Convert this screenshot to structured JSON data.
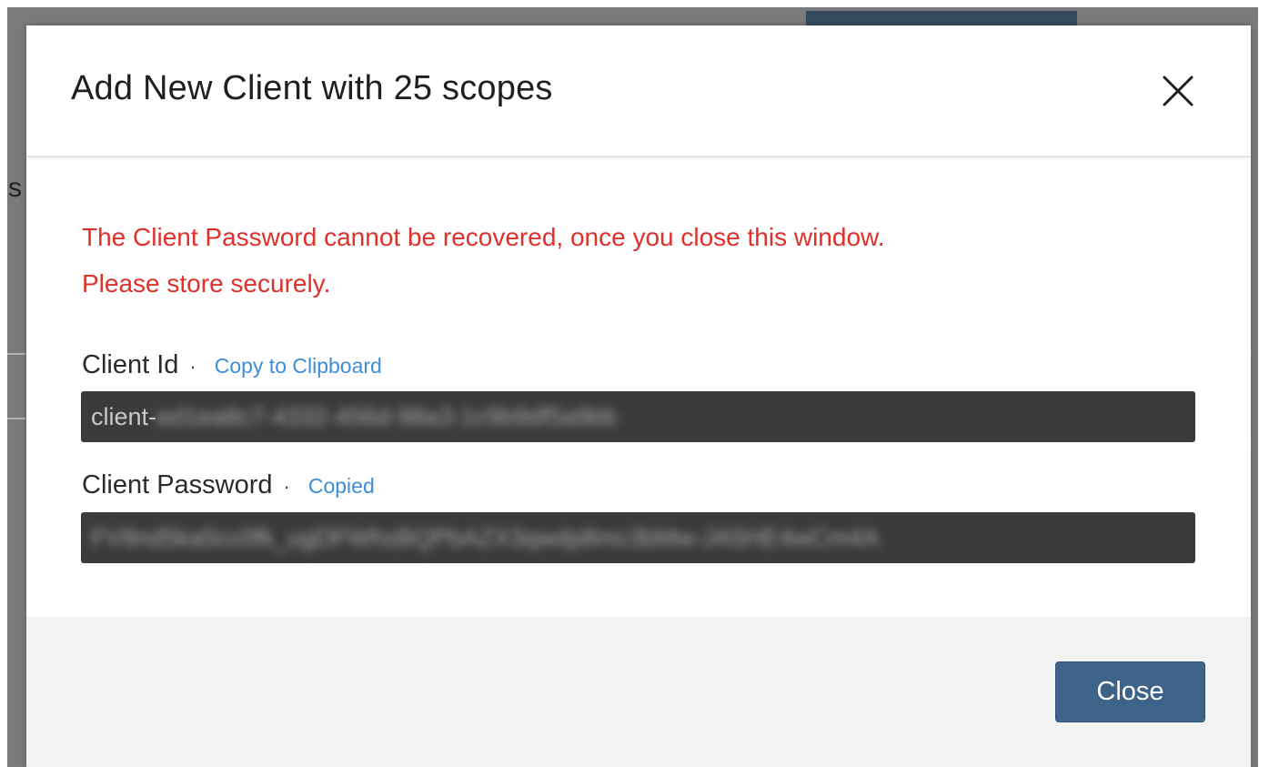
{
  "dialog": {
    "title": "Add New Client with 25 scopes",
    "close_icon": "close-icon",
    "warning_line1": "The Client Password cannot be recovered, once you close this window.",
    "warning_line2": "Please store securely.",
    "client_id": {
      "label": "Client Id",
      "separator": "·",
      "action": "Copy to Clipboard",
      "value_prefix": "client-",
      "value_masked": "ed1ea8c7-4332-456d-98a3-1c9b9df5a9bb"
    },
    "client_password": {
      "label": "Client Password",
      "separator": "·",
      "action": "Copied",
      "value_masked": "FV8nd5ka5cc0fk_ugDFWhsBQPbAZX3qwdp8mc3bMw-J4SHE4wCm4A"
    },
    "footer": {
      "close_label": "Close"
    }
  },
  "background": {
    "partial_letter": "s"
  },
  "colors": {
    "warning": "#e0302a",
    "link": "#3d8ed6",
    "primary_button": "#3d6389",
    "field_background": "#3b3b3b"
  }
}
